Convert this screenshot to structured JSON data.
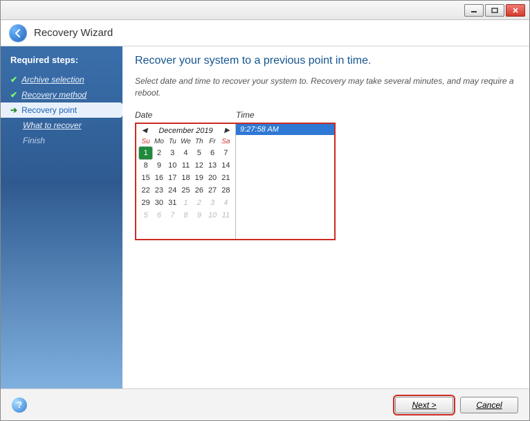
{
  "window": {
    "title": "Recovery Wizard"
  },
  "sidebar": {
    "heading": "Required steps:",
    "steps": [
      {
        "label": "Archive selection",
        "state": "done"
      },
      {
        "label": "Recovery method",
        "state": "done"
      },
      {
        "label": "Recovery point",
        "state": "current"
      },
      {
        "label": "What to recover",
        "state": "pending"
      },
      {
        "label": "Finish",
        "state": "disabled"
      }
    ]
  },
  "main": {
    "title": "Recover your system to a previous point in time.",
    "subtitle": "Select date and time to recover your system to. Recovery may take several minutes, and may require a reboot.",
    "date_label": "Date",
    "time_label": "Time"
  },
  "calendar": {
    "month_label": "December 2019",
    "dow": [
      "Su",
      "Mo",
      "Tu",
      "We",
      "Th",
      "Fr",
      "Sa"
    ],
    "weekend_indices": [
      0,
      6
    ],
    "selected_day": 1,
    "days": [
      {
        "n": 1
      },
      {
        "n": 2
      },
      {
        "n": 3
      },
      {
        "n": 4
      },
      {
        "n": 5
      },
      {
        "n": 6
      },
      {
        "n": 7
      },
      {
        "n": 8
      },
      {
        "n": 9
      },
      {
        "n": 10
      },
      {
        "n": 11
      },
      {
        "n": 12
      },
      {
        "n": 13
      },
      {
        "n": 14
      },
      {
        "n": 15
      },
      {
        "n": 16
      },
      {
        "n": 17
      },
      {
        "n": 18
      },
      {
        "n": 19
      },
      {
        "n": 20
      },
      {
        "n": 21
      },
      {
        "n": 22
      },
      {
        "n": 23
      },
      {
        "n": 24
      },
      {
        "n": 25
      },
      {
        "n": 26
      },
      {
        "n": 27
      },
      {
        "n": 28
      },
      {
        "n": 29
      },
      {
        "n": 30
      },
      {
        "n": 31
      },
      {
        "n": 1,
        "other": true
      },
      {
        "n": 2,
        "other": true
      },
      {
        "n": 3,
        "other": true
      },
      {
        "n": 4,
        "other": true
      },
      {
        "n": 5,
        "other": true
      },
      {
        "n": 6,
        "other": true
      },
      {
        "n": 7,
        "other": true
      },
      {
        "n": 8,
        "other": true
      },
      {
        "n": 9,
        "other": true
      },
      {
        "n": 10,
        "other": true
      },
      {
        "n": 11,
        "other": true
      }
    ]
  },
  "time_list": {
    "items": [
      "9:27:58 AM"
    ],
    "selected_index": 0
  },
  "footer": {
    "next_label": "Next >",
    "cancel_label": "Cancel"
  }
}
